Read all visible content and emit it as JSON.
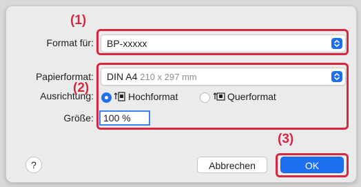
{
  "callouts": {
    "one": "(1)",
    "two": "(2)",
    "three": "(3)"
  },
  "format_for": {
    "label": "Format für:",
    "value": "BP-xxxxx"
  },
  "paper_size": {
    "label": "Papierformat:",
    "value": "DIN A4",
    "dimensions": "210 x 297 mm"
  },
  "orientation": {
    "label": "Ausrichtung:",
    "options": [
      {
        "label": "Hochformat",
        "selected": true
      },
      {
        "label": "Querformat",
        "selected": false
      }
    ]
  },
  "scale": {
    "label": "Größe:",
    "value": "100 %"
  },
  "buttons": {
    "help": "?",
    "cancel": "Abbrechen",
    "ok": "OK"
  },
  "colors": {
    "accent": "#1e6ff0",
    "callout": "#d62640"
  },
  "icons": {
    "stepper": "chevron-up-down-icon",
    "portrait": "portrait-orientation-icon",
    "landscape": "landscape-orientation-icon"
  }
}
